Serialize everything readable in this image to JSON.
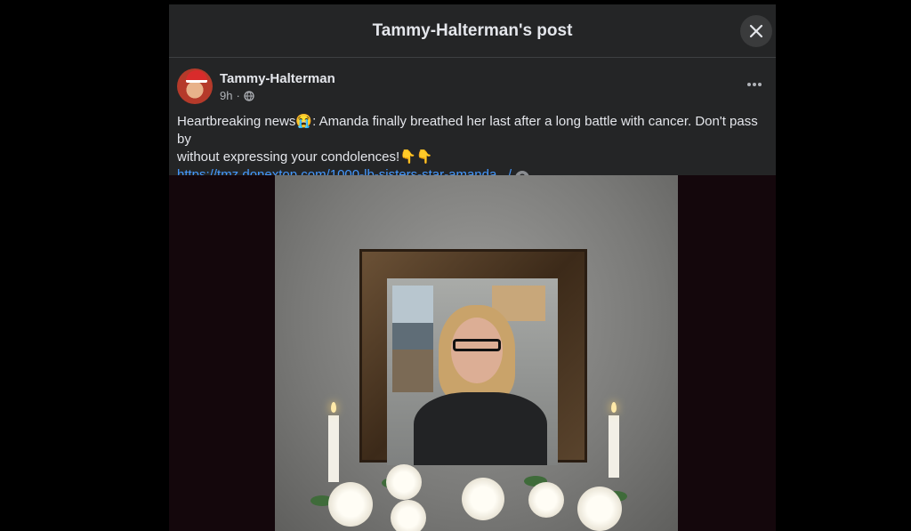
{
  "modal": {
    "title": "Tammy-Halterman's post"
  },
  "post": {
    "author": "Tammy-Halterman",
    "time": "9h",
    "separator": "·",
    "privacy_icon": "globe-icon",
    "text_line1": "Heartbreaking news😭: Amanda finally breathed her last after a long battle with cancer. Don't pass by",
    "text_line2": "without expressing your condolences!👇👇",
    "link": "https://tmz.donextop.com/1000-lb-sisters-star-amanda.../",
    "link_help": "?"
  },
  "icons": {
    "close": "close-icon",
    "more": "more-options-icon"
  },
  "colors": {
    "modal_bg": "#242526",
    "text": "#e4e6eb",
    "muted": "#b0b3b8",
    "link": "#4599ff"
  }
}
